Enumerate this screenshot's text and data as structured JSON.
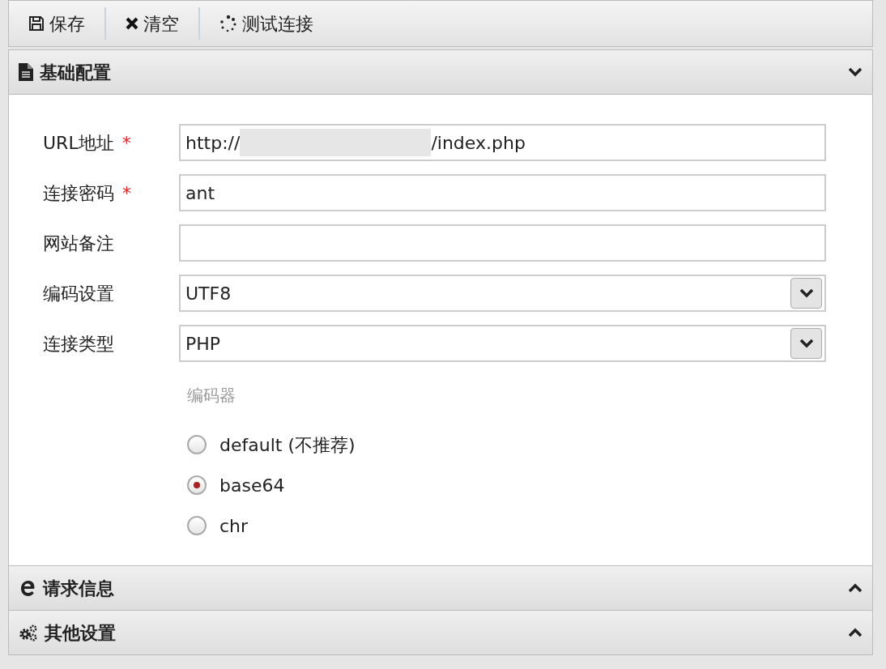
{
  "toolbar": [
    {
      "kind": "save",
      "label": "保存"
    },
    {
      "kind": "clear",
      "label": "清空"
    },
    {
      "kind": "test",
      "label": "测试连接"
    }
  ],
  "sections": [
    {
      "kind": "file",
      "title": "基础配置",
      "expanded": true
    },
    {
      "kind": "browser",
      "title": "请求信息",
      "expanded": false
    },
    {
      "kind": "gears",
      "title": "其他设置",
      "expanded": false
    }
  ],
  "form": {
    "fields": [
      {
        "kind": "text",
        "label": "URL地址",
        "required_mark": "*",
        "value_start": "http://",
        "redacted": true,
        "value_end": "/index.php"
      },
      {
        "kind": "text",
        "label": "连接密码",
        "required_mark": "*",
        "value_start": "ant",
        "redacted": false
      },
      {
        "kind": "text",
        "label": "网站备注",
        "redacted": false
      },
      {
        "kind": "select",
        "label": "编码设置",
        "value_start": "UTF8",
        "redacted": false
      },
      {
        "kind": "select",
        "label": "连接类型",
        "value_start": "PHP",
        "redacted": false
      }
    ],
    "encoder": {
      "label": "编码器",
      "options": [
        {
          "label": "default (不推荐)",
          "selected": false
        },
        {
          "label": "base64",
          "selected": true
        },
        {
          "label": "chr",
          "selected": false
        }
      ]
    }
  }
}
